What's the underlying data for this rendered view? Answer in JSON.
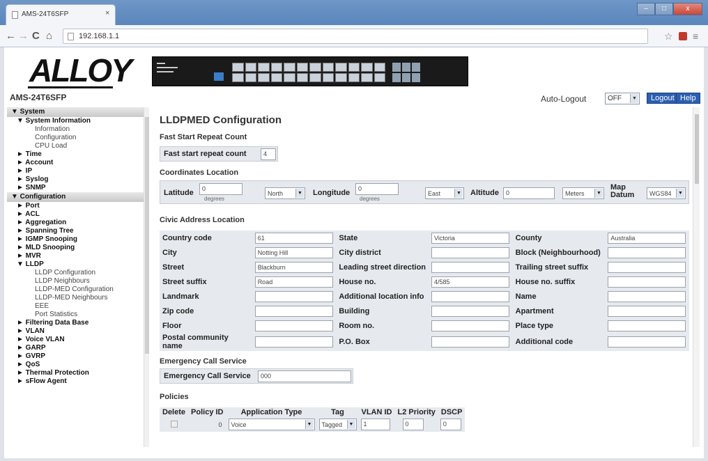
{
  "browser": {
    "tab_title": "AMS-24T6SFP",
    "tab_close": "×",
    "url": "192.168.1.1",
    "back": "←",
    "forward": "→",
    "reload": "C",
    "home": "⌂",
    "star": "☆",
    "menu": "≡",
    "win_min": "–",
    "win_max": "□",
    "win_close": "x"
  },
  "header": {
    "logo": "ALLOY",
    "model": "AMS-24T6SFP",
    "auto_logout_label": "Auto-Logout",
    "auto_logout_value": "OFF",
    "logout": "Logout",
    "help": "Help"
  },
  "sidebar": {
    "items": [
      {
        "level": "sec",
        "label": "▼ System"
      },
      {
        "level": "l1",
        "label": "▼ System Information"
      },
      {
        "level": "l2",
        "label": "Information"
      },
      {
        "level": "l2",
        "label": "Configuration"
      },
      {
        "level": "l2",
        "label": "CPU Load"
      },
      {
        "level": "l1",
        "label": "► Time"
      },
      {
        "level": "l1",
        "label": "► Account"
      },
      {
        "level": "l1",
        "label": "► IP"
      },
      {
        "level": "l1",
        "label": "► Syslog"
      },
      {
        "level": "l1",
        "label": "► SNMP"
      },
      {
        "level": "sec",
        "label": "▼ Configuration"
      },
      {
        "level": "l1",
        "label": "► Port"
      },
      {
        "level": "l1",
        "label": "► ACL"
      },
      {
        "level": "l1",
        "label": "► Aggregation"
      },
      {
        "level": "l1",
        "label": "► Spanning Tree"
      },
      {
        "level": "l1",
        "label": "► IGMP Snooping"
      },
      {
        "level": "l1",
        "label": "► MLD Snooping"
      },
      {
        "level": "l1",
        "label": "► MVR"
      },
      {
        "level": "l1",
        "label": "▼ LLDP"
      },
      {
        "level": "l2",
        "label": "LLDP Configuration"
      },
      {
        "level": "l2",
        "label": "LLDP Neighbours"
      },
      {
        "level": "l2",
        "label": "LLDP-MED Configuration"
      },
      {
        "level": "l2",
        "label": "LLDP-MED Neighbours"
      },
      {
        "level": "l2",
        "label": "EEE"
      },
      {
        "level": "l2",
        "label": "Port Statistics"
      },
      {
        "level": "l1",
        "label": "► Filtering Data Base"
      },
      {
        "level": "l1",
        "label": "► VLAN"
      },
      {
        "level": "l1",
        "label": "► Voice VLAN"
      },
      {
        "level": "l1",
        "label": "► GARP"
      },
      {
        "level": "l1",
        "label": "► GVRP"
      },
      {
        "level": "l1",
        "label": "► QoS"
      },
      {
        "level": "l1",
        "label": "► Thermal Protection"
      },
      {
        "level": "l1",
        "label": "► sFlow Agent"
      }
    ]
  },
  "main": {
    "title": "LLDPMED Configuration",
    "fast_start": {
      "heading": "Fast Start Repeat Count",
      "label": "Fast start repeat count",
      "value": "4"
    },
    "coords": {
      "heading": "Coordinates Location",
      "latitude_label": "Latitude",
      "latitude_value": "0",
      "latitude_unit": "degrees",
      "latitude_dir": "North",
      "longitude_label": "Longitude",
      "longitude_value": "0",
      "longitude_unit": "degrees",
      "longitude_dir": "East",
      "altitude_label": "Altitude",
      "altitude_value": "0",
      "altitude_unit": "Meters",
      "map_datum_label": "Map Datum",
      "map_datum_value": "WGS84"
    },
    "civic": {
      "heading": "Civic Address Location",
      "rows": [
        [
          {
            "label": "Country code",
            "value": "61"
          },
          {
            "label": "State",
            "value": "Victoria"
          },
          {
            "label": "County",
            "value": "Australia"
          }
        ],
        [
          {
            "label": "City",
            "value": "Notting Hill"
          },
          {
            "label": "City district",
            "value": ""
          },
          {
            "label": "Block (Neighbourhood)",
            "value": ""
          }
        ],
        [
          {
            "label": "Street",
            "value": "Blackburn"
          },
          {
            "label": "Leading street direction",
            "value": ""
          },
          {
            "label": "Trailing street suffix",
            "value": ""
          }
        ],
        [
          {
            "label": "Street suffix",
            "value": "Road"
          },
          {
            "label": "House no.",
            "value": "4/585"
          },
          {
            "label": "House no. suffix",
            "value": ""
          }
        ],
        [
          {
            "label": "Landmark",
            "value": ""
          },
          {
            "label": "Additional location info",
            "value": ""
          },
          {
            "label": "Name",
            "value": ""
          }
        ],
        [
          {
            "label": "Zip code",
            "value": ""
          },
          {
            "label": "Building",
            "value": ""
          },
          {
            "label": "Apartment",
            "value": ""
          }
        ],
        [
          {
            "label": "Floor",
            "value": ""
          },
          {
            "label": "Room no.",
            "value": ""
          },
          {
            "label": "Place type",
            "value": ""
          }
        ],
        [
          {
            "label": "Postal community name",
            "value": ""
          },
          {
            "label": "P.O. Box",
            "value": ""
          },
          {
            "label": "Additional code",
            "value": ""
          }
        ]
      ]
    },
    "emergency": {
      "heading": "Emergency Call Service",
      "label": "Emergency Call Service",
      "value": "000"
    },
    "policies": {
      "heading": "Policies",
      "columns": [
        "Delete",
        "Policy ID",
        "Application Type",
        "Tag",
        "VLAN ID",
        "L2 Priority",
        "DSCP"
      ],
      "row": {
        "policy_id": "0",
        "application_type": "Voice",
        "tag": "Tagged",
        "vlan_id": "1",
        "l2_priority": "0",
        "dscp": "0"
      }
    }
  }
}
